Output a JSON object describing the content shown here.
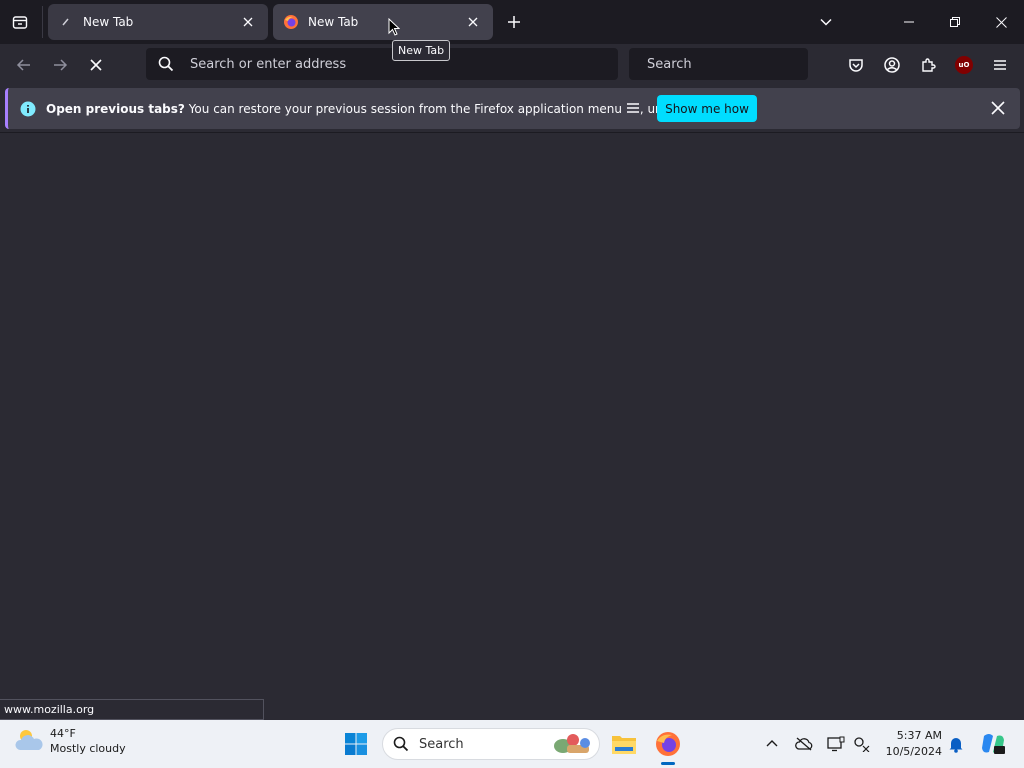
{
  "browser": {
    "tabs": [
      {
        "title": "New Tab",
        "active": false
      },
      {
        "title": "New Tab",
        "active": true
      }
    ],
    "tooltip": "New Tab",
    "url_placeholder": "Search or enter address",
    "search_placeholder": "Search",
    "ublock_label": "uO"
  },
  "notification": {
    "bold": "Open previous tabs?",
    "message": " You can restore your previous session from the Firefox application menu ",
    "message_end": ", under History.",
    "button": "Show me how"
  },
  "status_bar": "www.mozilla.org",
  "taskbar": {
    "weather_temp": "44°F",
    "weather_desc": "Mostly cloudy",
    "search_label": "Search",
    "time": "5:37 AM",
    "date": "10/5/2024"
  },
  "colors": {
    "accent": "#00ddff",
    "chrome_dark": "#1c1b22",
    "toolbar": "#2b2a33"
  },
  "icons": [
    "tab-list-icon",
    "close-icon",
    "plus-icon",
    "chevron-down-icon",
    "minimize-icon",
    "restore-icon",
    "back-arrow-icon",
    "forward-arrow-icon",
    "stop-icon",
    "search-icon",
    "pocket-icon",
    "account-icon",
    "extensions-icon",
    "ublock-icon",
    "hamburger-menu-icon",
    "info-icon",
    "windows-start-icon",
    "file-explorer-icon",
    "firefox-icon",
    "copilot-icon",
    "bell-icon"
  ]
}
